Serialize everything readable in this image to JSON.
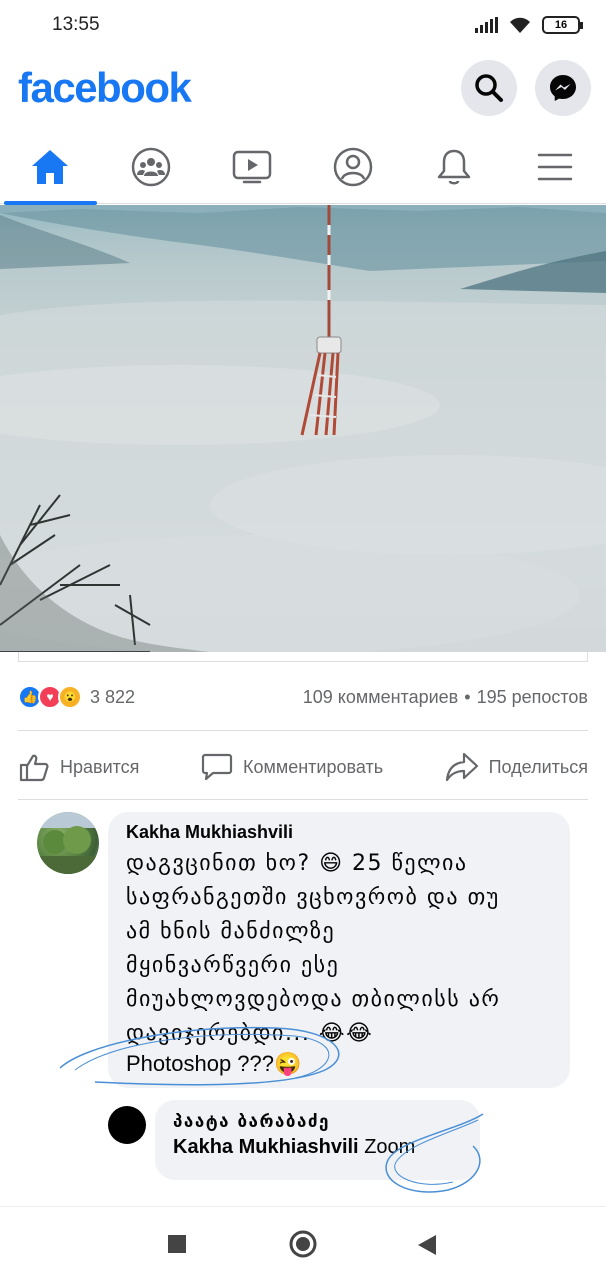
{
  "status_bar": {
    "time": "13:55",
    "battery": "16"
  },
  "header": {
    "logo": "facebook",
    "search_icon": "search-icon",
    "messenger_icon": "messenger-icon"
  },
  "nav": {
    "tabs": [
      {
        "name": "home",
        "icon": "home-icon",
        "active": true
      },
      {
        "name": "groups",
        "icon": "groups-icon"
      },
      {
        "name": "watch",
        "icon": "video-icon"
      },
      {
        "name": "profile",
        "icon": "profile-icon"
      },
      {
        "name": "notifications",
        "icon": "bell-icon"
      },
      {
        "name": "menu",
        "icon": "menu-icon"
      }
    ],
    "accent": "#1877f2"
  },
  "post": {
    "image_icon": "tv-tower-in-fog-image",
    "reactions_count": "3 822",
    "comments_count": "109 комментариев",
    "separator": "•",
    "shares_count": "195 репостов",
    "actions": {
      "like": "Нравится",
      "comment": "Комментировать",
      "share": "Поделиться"
    }
  },
  "comments": [
    {
      "author": "Kakha Mukhiashvili",
      "lines": [
        "დაგვცინით ხო? 😄 25 წელია",
        "საფრანგეთში ვცხოვრობ და თუ",
        "ამ ხნის მანძილზე",
        "მყინვარწვერი ესე",
        "მიუახლოვდებოდა თბილისს არ",
        "დავიჯერებდი... 😂😂"
      ],
      "last_line": "Photoshop ???😜"
    },
    {
      "author": "პაატა ბარაბაძე",
      "mention": "Kakha Mukhiashvili",
      "text": "Zoom"
    }
  ],
  "system_nav": {
    "recents": "square-icon",
    "home": "circle-icon",
    "back": "back-triangle-icon"
  }
}
